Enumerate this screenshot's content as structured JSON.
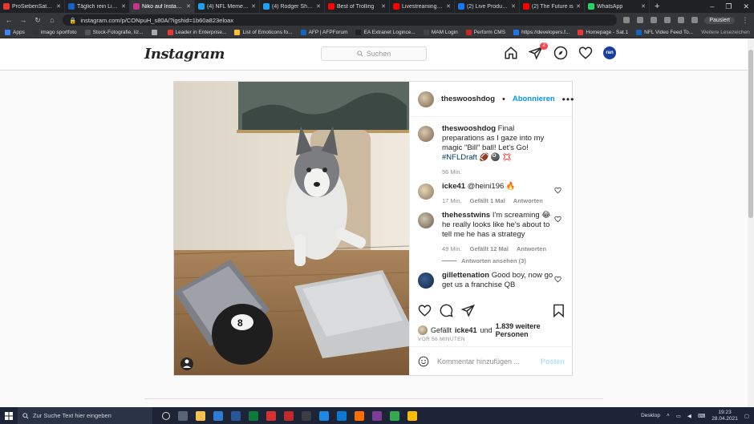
{
  "browser": {
    "tabs": [
      {
        "label": "ProSiebenSat.1 Intr",
        "color": "#e53935",
        "active": false
      },
      {
        "label": "Täglich rein Livestr",
        "color": "#1565c0",
        "active": false
      },
      {
        "label": "Niko auf Instagram",
        "color": "#c13584",
        "active": true
      },
      {
        "label": "(4) NFL Memes au",
        "color": "#1da1f2",
        "active": false
      },
      {
        "label": "(4) Rodger Sherm",
        "color": "#1da1f2",
        "active": false
      },
      {
        "label": "Best of Trolling",
        "color": "#ff0000",
        "active": false
      },
      {
        "label": "Livestreaming - Y",
        "color": "#ff0000",
        "active": false
      },
      {
        "label": "(2) Live Producer",
        "color": "#1877f2",
        "active": false
      },
      {
        "label": "(2) The Future is ",
        "color": "#ff0000",
        "active": false
      },
      {
        "label": "WhatsApp",
        "color": "#25d366",
        "active": false
      }
    ],
    "url": "instagram.com/p/CONpuH_s80A/?igshid=1b60a823eloax",
    "paused_label": "Pausiert",
    "bookmarks": [
      {
        "label": "Apps",
        "color": "#4285f4"
      },
      {
        "label": "imago sportfoto",
        "color": "#333333"
      },
      {
        "label": "Stock-Fotografie, liz...",
        "color": "#555555"
      },
      {
        "label": "",
        "color": "#aaaaaa"
      },
      {
        "label": "Leader in Enterprise...",
        "color": "#e53935"
      },
      {
        "label": "List of Emoticons fo...",
        "color": "#fbc02d"
      },
      {
        "label": "AFP | AFPForum",
        "color": "#1565c0"
      },
      {
        "label": "EA Extranet Logince...",
        "color": "#222222"
      },
      {
        "label": "MAM Login",
        "color": "#444444"
      },
      {
        "label": "Perform CMS",
        "color": "#c62828"
      },
      {
        "label": "https://developers.f...",
        "color": "#1877f2"
      },
      {
        "label": "Homepage - Sat.1",
        "color": "#e53935"
      },
      {
        "label": "NFL Video Feed To...",
        "color": "#1565c0"
      }
    ],
    "bookmarks_more": "Weitere Lesezeichen",
    "reading_list": "Leseliste"
  },
  "instagram": {
    "logo": "Instagram",
    "search_placeholder": "Suchen",
    "dm_badge": "2",
    "profile_initials": "ran",
    "post": {
      "author": "theswooshdog",
      "separator": "•",
      "follow_label": "Abonnieren",
      "caption_text": "Final preparations as I gaze into my magic \"Bill\" ball! Let's Go!",
      "caption_hashtag": "#NFLDraft",
      "caption_emoji": "🏈 🎱 💢",
      "caption_time": "56 Min.",
      "comments": [
        {
          "user": "icke41",
          "text": "@heini196 🔥",
          "time": "17 Min.",
          "likes": "Gefällt 1 Mal",
          "reply": "Antworten"
        },
        {
          "user": "thehesstwins",
          "text": "I'm screaming 😂 he really looks like he's about to tell me he has a strategy",
          "time": "49 Min.",
          "likes": "Gefällt 12 Mal",
          "reply": "Antworten"
        },
        {
          "user": "gillettenation",
          "text": "Good boy, now go get us a franchise QB",
          "time": "",
          "likes": "",
          "reply": ""
        }
      ],
      "view_replies": "Antworten ansehen (3)",
      "liked_by_prefix": "Gefällt",
      "liked_by_user": "icke41",
      "liked_by_and": "und",
      "liked_by_count": "1.839 weitere Personen",
      "timestamp": "VOR 56 MINUTEN",
      "add_comment_placeholder": "Kommentar hinzufügen ...",
      "post_button": "Posten"
    }
  },
  "taskbar": {
    "search_placeholder": "Zur Suche Text hier eingeben",
    "desktop_label": "Desktop",
    "time": "19:23",
    "date": "28.04.2021"
  }
}
